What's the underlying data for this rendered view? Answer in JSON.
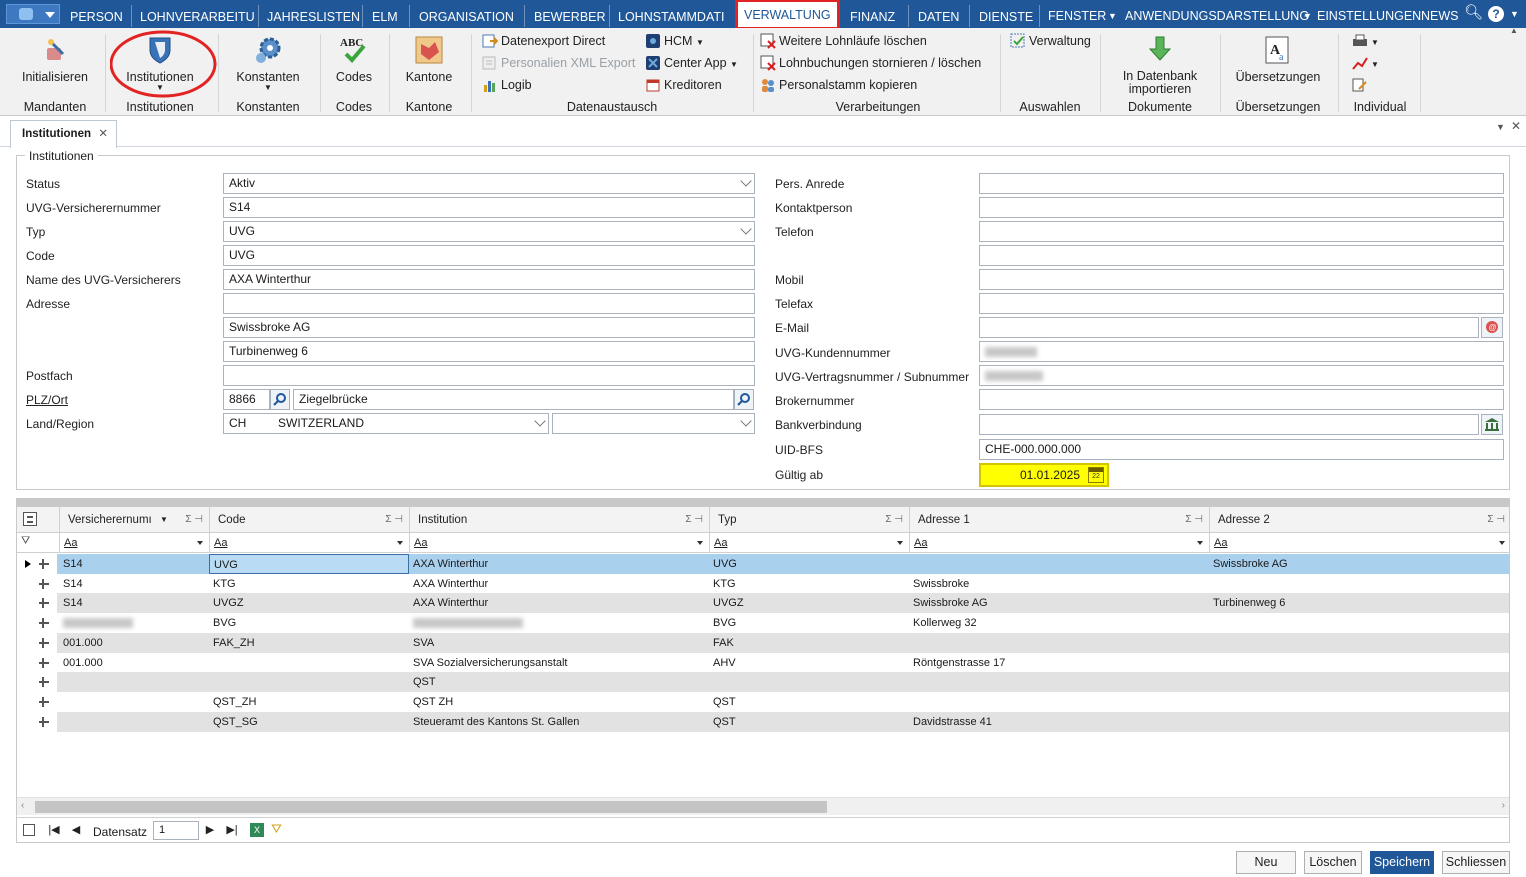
{
  "menu": {
    "items": [
      "PERSON",
      "LOHNVERARBEITU",
      "JAHRESLISTEN",
      "ELM",
      "ORGANISATION",
      "BEWERBER",
      "LOHNSTAMMDATI",
      "VERWALTUNG",
      "FINANZ",
      "DATEN",
      "DIENSTE",
      "FENSTER",
      "ANWENDUNGSDARSTELLUNG",
      "EINSTELLUNGEN",
      "NEWS"
    ],
    "active": "VERWALTUNG"
  },
  "ribbon": {
    "groups": {
      "mandanten": {
        "button": "Initialisieren",
        "label": "Mandanten"
      },
      "institutionen": {
        "button": "Institutionen",
        "label": "Institutionen"
      },
      "konstanten": {
        "button": "Konstanten",
        "label": "Konstanten"
      },
      "codes": {
        "button": "Codes",
        "label": "Codes"
      },
      "kantone": {
        "button": "Kantone",
        "label": "Kantone"
      },
      "datenaustausch": {
        "label": "Datenaustausch",
        "items": [
          "Datenexport Direct",
          "Personalien XML Export",
          "Logib",
          "HCM",
          "Center App",
          "Kreditoren"
        ]
      },
      "verarbeitungen": {
        "label": "Verarbeitungen",
        "items": [
          "Weitere Lohnläufe löschen",
          "Lohnbuchungen stornieren / löschen",
          "Personalstamm kopieren"
        ]
      },
      "auswahlen": {
        "label": "Auswahlen",
        "item": "Verwaltung"
      },
      "dokumente": {
        "label": "Dokumente",
        "button_line1": "In Datenbank",
        "button_line2": "importieren"
      },
      "uebersetzungen": {
        "label": "Übersetzungen",
        "button": "Übersetzungen"
      },
      "individual": {
        "label": "Individual"
      }
    }
  },
  "tab": {
    "title": "Institutionen"
  },
  "form": {
    "legend": "Institutionen",
    "left": {
      "status": {
        "label": "Status",
        "value": "Aktiv"
      },
      "uvg_nr": {
        "label": "UVG-Versicherernummer",
        "value": "S14"
      },
      "typ": {
        "label": "Typ",
        "value": "UVG"
      },
      "code": {
        "label": "Code",
        "value": "UVG"
      },
      "name": {
        "label": "Name des UVG-Versicherers",
        "value": "AXA Winterthur"
      },
      "adresse": {
        "label": "Adresse",
        "value1": "",
        "value2": "Swissbroke AG",
        "value3": "Turbinenweg 6"
      },
      "postfach": {
        "label": "Postfach",
        "value": ""
      },
      "plzort": {
        "label": "PLZ/Ort",
        "plz": "8866",
        "ort": "Ziegelbrücke"
      },
      "land": {
        "label": "Land/Region",
        "code": "CH",
        "name": "SWITZERLAND",
        "region": ""
      }
    },
    "right": {
      "anrede": {
        "label": "Pers. Anrede",
        "value": ""
      },
      "kontakt": {
        "label": "Kontaktperson",
        "value": ""
      },
      "telefon": {
        "label": "Telefon",
        "value": ""
      },
      "telefon2": {
        "value": ""
      },
      "mobil": {
        "label": "Mobil",
        "value": ""
      },
      "telefax": {
        "label": "Telefax",
        "value": ""
      },
      "email": {
        "label": "E-Mail",
        "value": ""
      },
      "kundennr": {
        "label": "UVG-Kundennummer"
      },
      "vertragsnr": {
        "label": "UVG-Vertragsnummer / Subnummer"
      },
      "brokernr": {
        "label": "Brokernummer",
        "value": ""
      },
      "bank": {
        "label": "Bankverbindung",
        "value": ""
      },
      "uid": {
        "label": "UID-BFS",
        "value": "CHE-000.000.000"
      },
      "gueltig": {
        "label": "Gültig ab",
        "value": "01.01.2025"
      }
    }
  },
  "grid": {
    "columns": [
      "Versicherernumı",
      "Code",
      "Institution",
      "Typ",
      "Adresse 1",
      "Adresse 2"
    ],
    "filter": "Aa",
    "rows": [
      [
        "S14",
        "UVG",
        "AXA Winterthur",
        "UVG",
        "",
        "Swissbroke AG"
      ],
      [
        "S14",
        "KTG",
        "AXA Winterthur",
        "KTG",
        "Swissbroke",
        ""
      ],
      [
        "S14",
        "UVGZ",
        "AXA Winterthur",
        "UVGZ",
        "Swissbroke AG",
        "Turbinenweg 6"
      ],
      [
        "",
        "BVG",
        "",
        "BVG",
        "Kollerweg 32",
        ""
      ],
      [
        "001.000",
        "FAK_ZH",
        "SVA",
        "FAK",
        "",
        ""
      ],
      [
        "001.000",
        "",
        "SVA Sozialversicherungsanstalt",
        "AHV",
        "Röntgenstrasse 17",
        ""
      ],
      [
        "",
        "",
        "QST",
        "",
        "",
        ""
      ],
      [
        "",
        "QST_ZH",
        "QST ZH",
        "QST",
        "",
        ""
      ],
      [
        "",
        "QST_SG",
        "Steueramt des Kantons St. Gallen",
        "QST",
        "Davidstrasse 41",
        ""
      ]
    ],
    "nav": {
      "label": "Datensatz",
      "value": "1"
    }
  },
  "buttons": {
    "neu": "Neu",
    "loeschen": "Löschen",
    "speichern": "Speichern",
    "schliessen": "Schliessen"
  },
  "colors": {
    "menubar": "#1f5798",
    "highlight": "#e32222",
    "selected_row": "#a9d1ee",
    "date_field": "#ffff00"
  }
}
